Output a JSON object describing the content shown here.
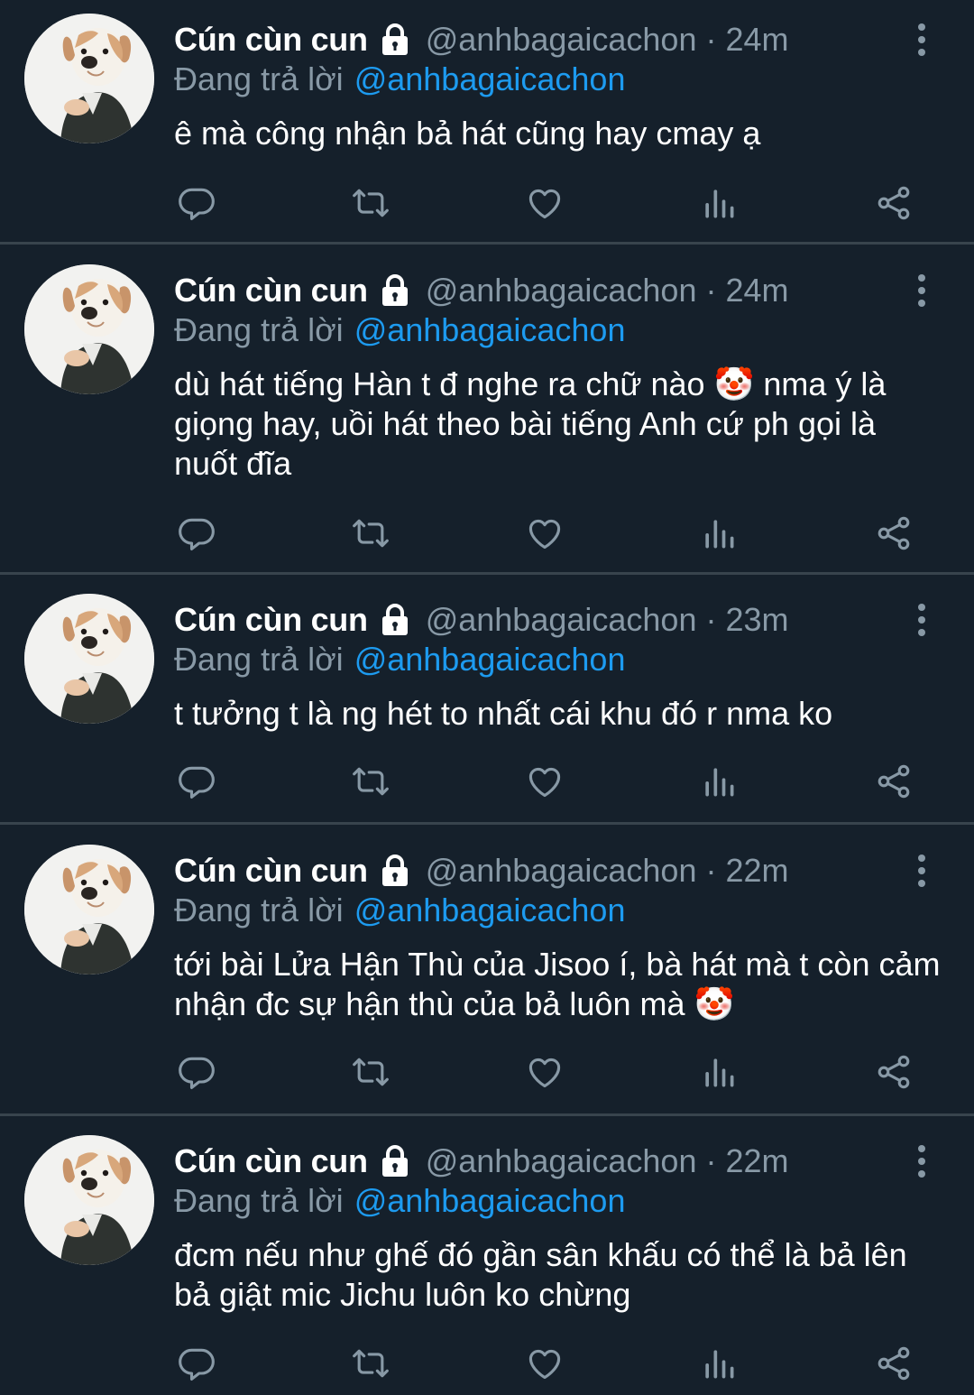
{
  "colors": {
    "background": "#15202b",
    "divider": "#38444d",
    "secondary_text": "#8899a6",
    "link": "#1d9bf0",
    "primary_text": "#ffffff"
  },
  "icons": {
    "lock": "lock-icon",
    "more": "more-vertical-icon",
    "reply": "reply-icon",
    "retweet": "retweet-icon",
    "like": "heart-icon",
    "analytics": "analytics-icon",
    "share": "share-icon",
    "emoji": "clown-face-emoji"
  },
  "tweets": [
    {
      "name": "Cún cùn cun",
      "handle": "@anhbagaicachon",
      "separator": "·",
      "time": "24m",
      "reply_prefix": "Đang trả lời",
      "reply_to": "@anhbagaicachon",
      "text": "ê mà công nhận bả hát cũng hay cmay ạ"
    },
    {
      "name": "Cún cùn cun",
      "handle": "@anhbagaicachon",
      "separator": "·",
      "time": "24m",
      "reply_prefix": "Đang trả lời",
      "reply_to": "@anhbagaicachon",
      "text": "dù hát tiếng Hàn t đ nghe ra chữ nào 🤡 nma ý là giọng hay, uồi hát theo bài tiếng Anh cứ ph gọi là nuốt đĩa"
    },
    {
      "name": "Cún cùn cun",
      "handle": "@anhbagaicachon",
      "separator": "·",
      "time": "23m",
      "reply_prefix": "Đang trả lời",
      "reply_to": "@anhbagaicachon",
      "text": "t tưởng t là ng hét to nhất cái khu đó r nma ko"
    },
    {
      "name": "Cún cùn cun",
      "handle": "@anhbagaicachon",
      "separator": "·",
      "time": "22m",
      "reply_prefix": "Đang trả lời",
      "reply_to": "@anhbagaicachon",
      "text": "tới bài Lửa Hận Thù của Jisoo í, bà hát mà t còn cảm nhận đc sự hận thù của bả luôn mà 🤡"
    },
    {
      "name": "Cún cùn cun",
      "handle": "@anhbagaicachon",
      "separator": "·",
      "time": "22m",
      "reply_prefix": "Đang trả lời",
      "reply_to": "@anhbagaicachon",
      "text": "đcm nếu như ghế đó gần sân khấu có thể là bả lên bả giật mic Jichu luôn ko chừng"
    }
  ]
}
